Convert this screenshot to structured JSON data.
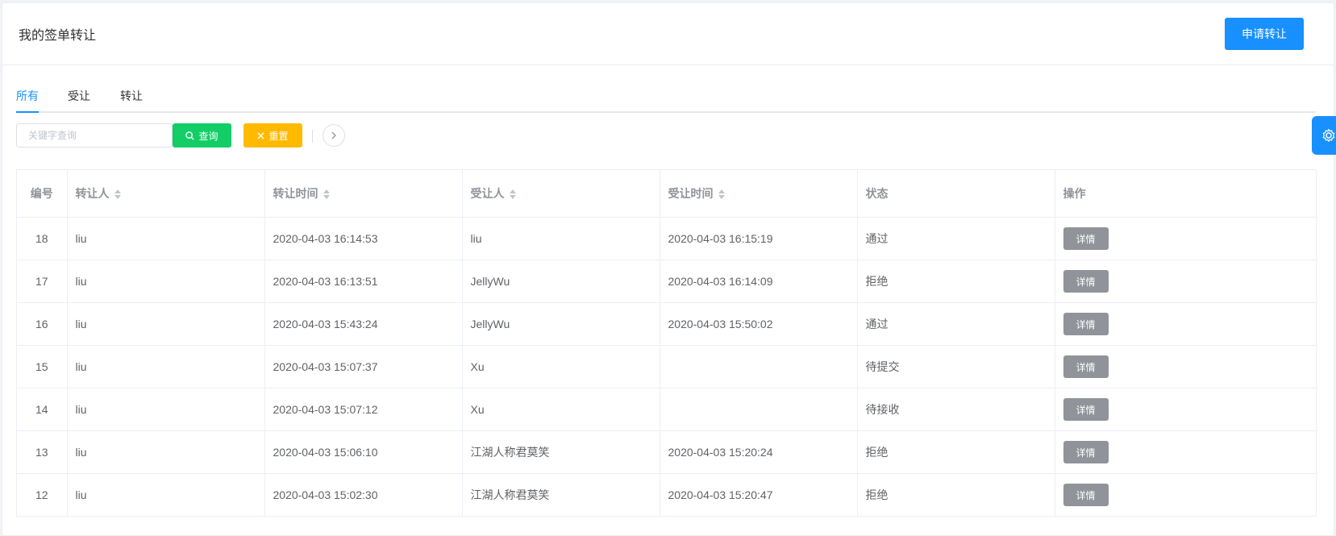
{
  "header": {
    "title": "我的签单转让",
    "apply_label": "申请转让"
  },
  "tabs": [
    {
      "label": "所有",
      "active": true
    },
    {
      "label": "受让",
      "active": false
    },
    {
      "label": "转让",
      "active": false
    }
  ],
  "toolbar": {
    "search_placeholder": "关键字查询",
    "search_value": "",
    "query_label": "查询",
    "reset_label": "重置",
    "query_color": "#13ce66",
    "reset_color": "#ffba00"
  },
  "table": {
    "columns": [
      "编号",
      "转让人",
      "转让时间",
      "受让人",
      "受让时间",
      "状态",
      "操作"
    ],
    "sortable": [
      false,
      true,
      true,
      true,
      true,
      false,
      false
    ],
    "action_label": "详情",
    "rows": [
      {
        "id": "18",
        "from": "liu",
        "from_time": "2020-04-03 16:14:53",
        "to": "liu",
        "to_time": "2020-04-03 16:15:19",
        "status": "通过"
      },
      {
        "id": "17",
        "from": "liu",
        "from_time": "2020-04-03 16:13:51",
        "to": "JellyWu",
        "to_time": "2020-04-03 16:14:09",
        "status": "拒绝"
      },
      {
        "id": "16",
        "from": "liu",
        "from_time": "2020-04-03 15:43:24",
        "to": "JellyWu",
        "to_time": "2020-04-03 15:50:02",
        "status": "通过"
      },
      {
        "id": "15",
        "from": "liu",
        "from_time": "2020-04-03 15:07:37",
        "to": "Xu",
        "to_time": "",
        "status": "待提交"
      },
      {
        "id": "14",
        "from": "liu",
        "from_time": "2020-04-03 15:07:12",
        "to": "Xu",
        "to_time": "",
        "status": "待接收"
      },
      {
        "id": "13",
        "from": "liu",
        "from_time": "2020-04-03 15:06:10",
        "to": "江湖人称君莫笑",
        "to_time": "2020-04-03 15:20:24",
        "status": "拒绝"
      },
      {
        "id": "12",
        "from": "liu",
        "from_time": "2020-04-03 15:02:30",
        "to": "江湖人称君莫笑",
        "to_time": "2020-04-03 15:20:47",
        "status": "拒绝"
      }
    ]
  },
  "colors": {
    "primary": "#1890ff",
    "muted_button": "#909399"
  },
  "icons": {
    "query": "search-icon",
    "reset": "close-icon",
    "expand": "chevron-right-icon",
    "settings": "gear-icon"
  }
}
